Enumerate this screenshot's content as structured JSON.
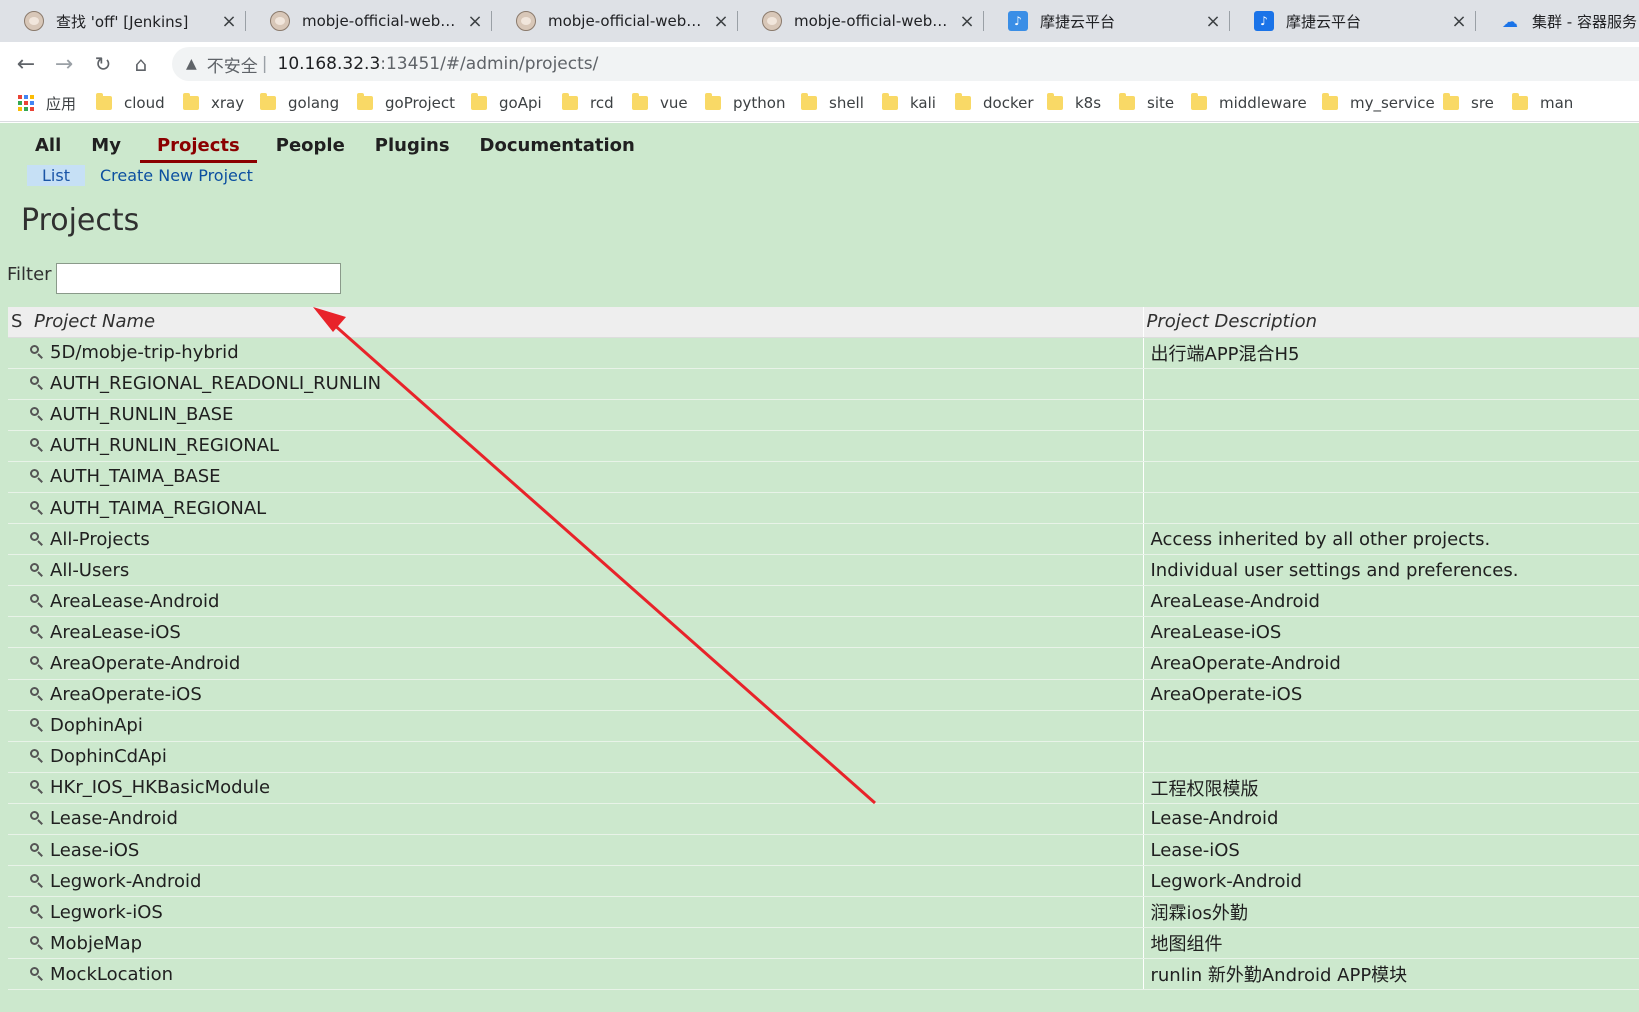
{
  "browser": {
    "tabs": [
      {
        "title": "查找 'off' [Jenkins]",
        "icon": "jenkins-icon"
      },
      {
        "title": "mobje-official-website_",
        "icon": "jenkins-icon"
      },
      {
        "title": "mobje-official-website_",
        "icon": "jenkins-icon"
      },
      {
        "title": "mobje-official-website_",
        "icon": "jenkins-icon"
      },
      {
        "title": "摩捷云平台",
        "icon": "mojie-icon"
      },
      {
        "title": "摩捷云平台",
        "icon": "mojie-icon"
      },
      {
        "title": "集群 - 容器服务",
        "icon": "cloud-icon"
      }
    ],
    "address": {
      "security_label": "不安全",
      "separator": "|",
      "host": "10.168.32.3",
      "rest": ":13451/#/admin/projects/"
    },
    "bookmarks": {
      "apps_label": "应用",
      "folders": [
        "cloud",
        "xray",
        "golang",
        "goProject",
        "goApi",
        "rcd",
        "vue",
        "python",
        "shell",
        "kali",
        "docker",
        "k8s",
        "site",
        "middleware",
        "my_service",
        "sre",
        "man"
      ]
    }
  },
  "gerrit": {
    "menu": [
      "All",
      "My",
      "Projects",
      "People",
      "Plugins",
      "Documentation"
    ],
    "active_menu": "Projects",
    "submenu": [
      "List",
      "Create New Project"
    ],
    "active_submenu": "List",
    "page_title": "Projects",
    "filter": {
      "label": "Filter",
      "value": ""
    },
    "table": {
      "headers": {
        "s": "S",
        "name": "Project Name",
        "description": "Project Description"
      },
      "rows": [
        {
          "name": "5D/mobje-trip-hybrid",
          "description": "出行端APP混合H5"
        },
        {
          "name": "AUTH_REGIONAL_READONLI_RUNLIN",
          "description": ""
        },
        {
          "name": "AUTH_RUNLIN_BASE",
          "description": ""
        },
        {
          "name": "AUTH_RUNLIN_REGIONAL",
          "description": ""
        },
        {
          "name": "AUTH_TAIMA_BASE",
          "description": ""
        },
        {
          "name": "AUTH_TAIMA_REGIONAL",
          "description": ""
        },
        {
          "name": "All-Projects",
          "description": "Access inherited by all other projects."
        },
        {
          "name": "All-Users",
          "description": "Individual user settings and preferences."
        },
        {
          "name": "AreaLease-Android",
          "description": "AreaLease-Android"
        },
        {
          "name": "AreaLease-iOS",
          "description": "AreaLease-iOS"
        },
        {
          "name": "AreaOperate-Android",
          "description": "AreaOperate-Android"
        },
        {
          "name": "AreaOperate-iOS",
          "description": "AreaOperate-iOS"
        },
        {
          "name": "DophinApi",
          "description": ""
        },
        {
          "name": "DophinCdApi",
          "description": ""
        },
        {
          "name": "HKr_IOS_HKBasicModule",
          "description": "工程权限模版"
        },
        {
          "name": "Lease-Android",
          "description": "Lease-Android"
        },
        {
          "name": "Lease-iOS",
          "description": "Lease-iOS"
        },
        {
          "name": "Legwork-Android",
          "description": "Legwork-Android"
        },
        {
          "name": "Legwork-iOS",
          "description": "润霖ios外勤"
        },
        {
          "name": "MobjeMap",
          "description": "地图组件"
        },
        {
          "name": "MockLocation",
          "description": "runlin 新外勤Android APP模块"
        }
      ]
    }
  },
  "annotation": {
    "arrow_color": "#e8232a"
  }
}
